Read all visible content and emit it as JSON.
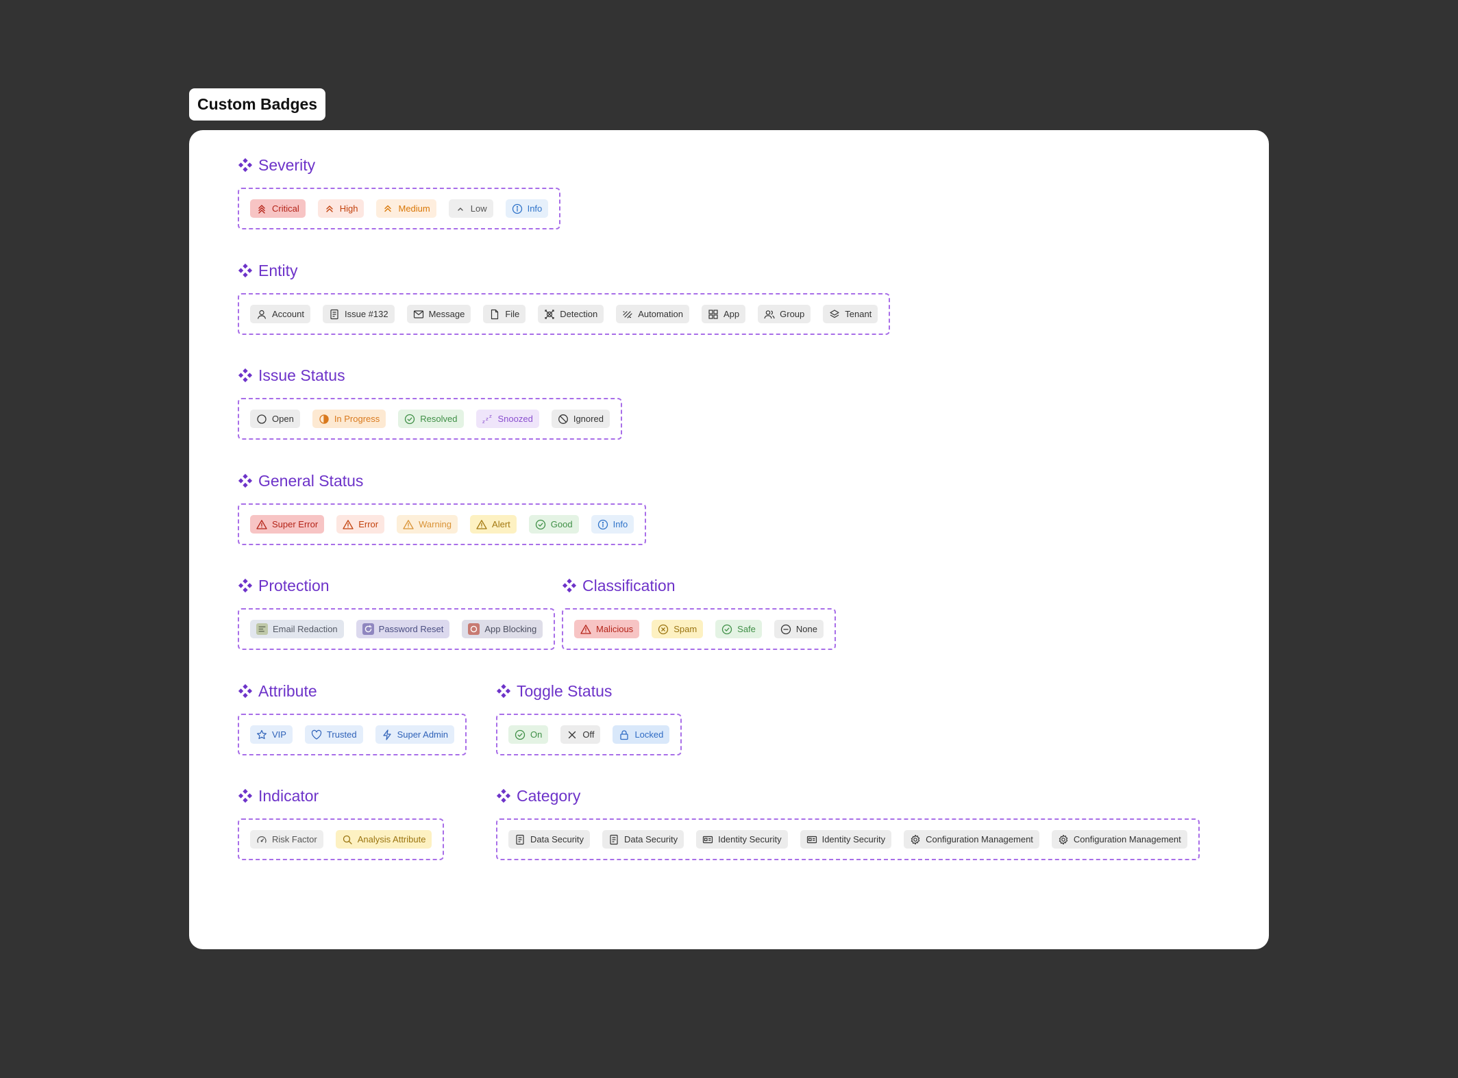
{
  "frame_title": "Custom Badges",
  "colors": {
    "accent": "#6d33c9",
    "dashed_border": "#a86ee8",
    "background": "#333333"
  },
  "sections": {
    "severity": {
      "title": "Severity",
      "badges": [
        "Critical",
        "High",
        "Medium",
        "Low",
        "Info"
      ]
    },
    "entity": {
      "title": "Entity",
      "badges": [
        "Account",
        "Issue #132",
        "Message",
        "File",
        "Detection",
        "Automation",
        "App",
        "Group",
        "Tenant"
      ]
    },
    "issue_status": {
      "title": "Issue Status",
      "badges": [
        "Open",
        "In Progress",
        "Resolved",
        "Snoozed",
        "Ignored"
      ]
    },
    "general_status": {
      "title": "General Status",
      "badges": [
        "Super Error",
        "Error",
        "Warning",
        "Alert",
        "Good",
        "Info"
      ]
    },
    "protection": {
      "title": "Protection",
      "badges": [
        "Email Redaction",
        "Password Reset",
        "App Blocking"
      ]
    },
    "classification": {
      "title": "Classification",
      "badges": [
        "Malicious",
        "Spam",
        "Safe",
        "None"
      ]
    },
    "attribute": {
      "title": "Attribute",
      "badges": [
        "VIP",
        "Trusted",
        "Super Admin"
      ]
    },
    "toggle_status": {
      "title": "Toggle Status",
      "badges": [
        "On",
        "Off",
        "Locked"
      ]
    },
    "indicator": {
      "title": "Indicator",
      "badges": [
        "Risk Factor",
        "Analysis Attribute"
      ]
    },
    "category": {
      "title": "Category",
      "badges": [
        "Data Security",
        "Data Security",
        "Identity Security",
        "Identity Security",
        "Configuration Management",
        "Configuration Management"
      ]
    }
  },
  "icons": {
    "severity": [
      "chevrons-triple-up-icon",
      "chevrons-double-up-icon",
      "chevrons-double-up-icon",
      "chevron-up-icon",
      "info-circle-icon"
    ],
    "entity": [
      "user-icon",
      "document-icon",
      "mail-icon",
      "file-icon",
      "detection-icon",
      "automation-icon",
      "grid-icon",
      "users-icon",
      "layers-icon"
    ],
    "issue_status": [
      "circle-icon",
      "half-circle-icon",
      "check-circle-icon",
      "zzz-icon",
      "block-icon"
    ],
    "general_status": [
      "warning-triangle-icon",
      "warning-triangle-icon",
      "warning-triangle-icon",
      "warning-triangle-icon",
      "check-circle-icon",
      "info-circle-icon"
    ],
    "protection": [
      "email-redaction-icon",
      "password-reset-icon",
      "app-blocking-icon"
    ],
    "classification": [
      "warning-triangle-icon",
      "x-circle-icon",
      "check-circle-icon",
      "minus-circle-icon"
    ],
    "attribute": [
      "star-icon",
      "heart-icon",
      "bolt-icon"
    ],
    "toggle_status": [
      "check-circle-icon",
      "x-icon",
      "lock-icon"
    ],
    "indicator": [
      "gauge-icon",
      "search-icon"
    ],
    "category": [
      "document-icon",
      "document-icon",
      "id-card-icon",
      "id-card-icon",
      "gear-icon",
      "gear-icon"
    ]
  }
}
